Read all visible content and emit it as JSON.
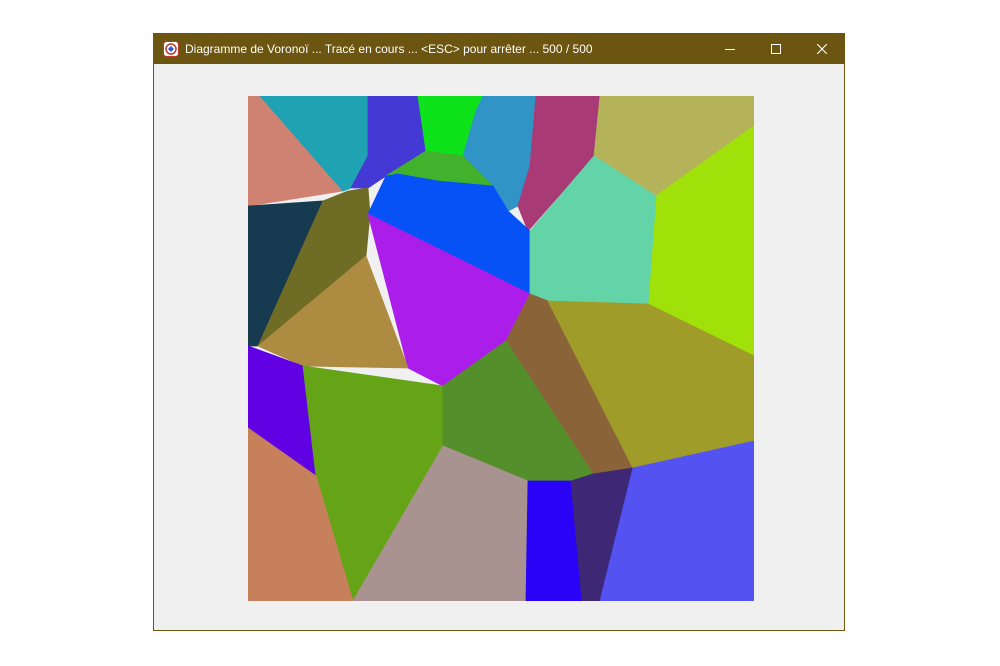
{
  "window": {
    "title": "Diagramme de Voronoï ... Tracé en cours ... <ESC> pour arrêter ... 500 / 500",
    "app_icon": "app-icon",
    "controls": {
      "minimize_icon": "minimize-icon",
      "maximize_icon": "maximize-icon",
      "close_icon": "close-icon"
    },
    "colors": {
      "titlebar": "#6b5510",
      "client": "#f0f0f0"
    }
  },
  "voronoi": {
    "cell_colors": [
      "#d08272",
      "#1fa3b3",
      "#4539d6",
      "#0ee21b",
      "#3194c6",
      "#a83a76",
      "#b5b35a",
      "#a0e10a",
      "#163a4f",
      "#6e6c25",
      "#42b22d",
      "#0652f7",
      "#62d4a8",
      "#ab1de9",
      "#ad8c42",
      "#8b6339",
      "#a09c2a",
      "#6200e4",
      "#65a417",
      "#558f2b",
      "#c6805c",
      "#a99391",
      "#2a03f6",
      "#3e2774",
      "#5453f2"
    ]
  }
}
